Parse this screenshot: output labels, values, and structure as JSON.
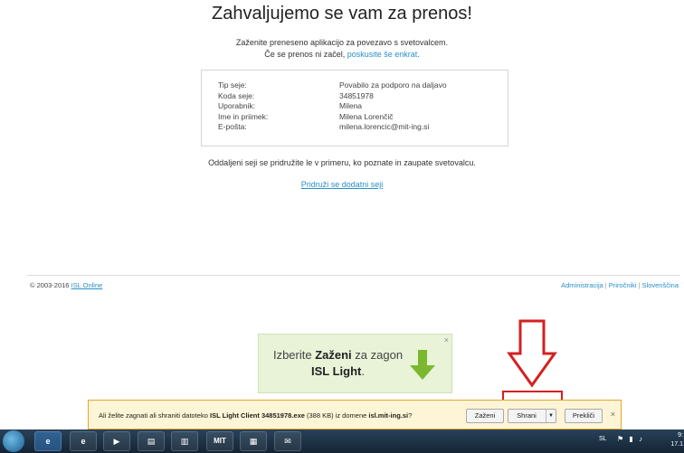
{
  "page": {
    "title": "Zahvaljujemo se vam za prenos!",
    "intro_line1": "Zaženite preneseno aplikacijo za povezavo s svetovalcem.",
    "intro_line2_prefix": "Če se prenos ni začel, ",
    "intro_retry_link": "poskusite še enkrat.",
    "info_rows": [
      {
        "label": "Tip seje:",
        "value": "Povabilo za podporo na daljavo"
      },
      {
        "label": "Koda seje:",
        "value": "34851978"
      },
      {
        "label": "Uporabnik:",
        "value": "Milena"
      },
      {
        "label": "Ime in priimek:",
        "value": "Milena Lorenčič"
      },
      {
        "label": "E-pošta:",
        "value": "milena.lorencic@mit-ing.si"
      }
    ],
    "note": "Oddaljeni seji se pridružite le v primeru, ko poznate in zaupate svetovalcu.",
    "join_link": "Pridruži se dodatni seji"
  },
  "footer": {
    "copyright": "© 2003-2016 ",
    "brand_link": "ISL Online",
    "links": [
      "Administracija",
      "Priročniki",
      "Slovenščina"
    ]
  },
  "hint": {
    "pre": "Izberite ",
    "bold": "Zaženi",
    "post": " za zagon",
    "app": "ISL Light",
    "app_suffix": ".",
    "close": "×"
  },
  "download_bar": {
    "text_pre": "Ali želite zagnati ali shraniti datoteko ",
    "file_name": "ISL Light Client 34851978.exe",
    "text_mid": " (388 KB) iz domene ",
    "domain": "isl.mit-ing.si",
    "text_end": "?",
    "run_label": "Zaženi",
    "save_label": "Shrani",
    "cancel_label": "Prekliči",
    "close": "×"
  },
  "taskbar": {
    "icons": [
      {
        "name": "ie-icon",
        "glyph": "e"
      },
      {
        "name": "ie-pinned-icon",
        "glyph": "e"
      },
      {
        "name": "media-player-icon",
        "glyph": "▶"
      },
      {
        "name": "explorer-icon",
        "glyph": "▤"
      },
      {
        "name": "app-icon",
        "glyph": "▥"
      },
      {
        "name": "mit-icon",
        "glyph": "MIT"
      },
      {
        "name": "windows-app-icon",
        "glyph": "▦"
      },
      {
        "name": "mail-icon",
        "glyph": "✉"
      }
    ],
    "language": "SL",
    "time": "9:",
    "date": "17.1"
  },
  "colors": {
    "link": "#2a8fc7",
    "hint_bg": "#e8f3d8",
    "hint_arrow": "#7cb82f",
    "download_bar_bg": "#fdf5d5",
    "annotation_red": "#d42020",
    "taskbar": "#1e3448"
  }
}
